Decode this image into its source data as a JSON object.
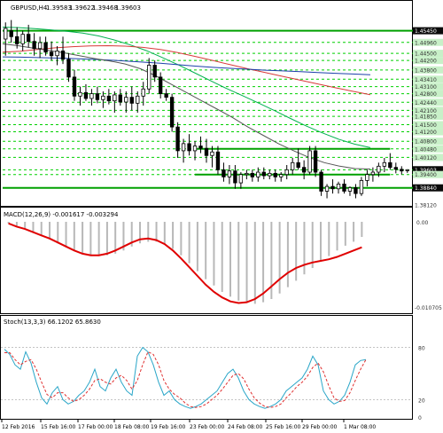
{
  "chart_data": [
    {
      "type": "candlestick",
      "symbol_line": "GBPUSD,H4",
      "ohlc_values": [
        "1.39583",
        "1.39622",
        "1.39468",
        "1.39603"
      ],
      "ylim": [
        1.3812,
        1.4622
      ],
      "y_tick_labels": [
        "1.45450",
        "1.44960",
        "1.44500",
        "1.44200",
        "1.43800",
        "1.43410",
        "1.43100",
        "1.42800",
        "1.42440",
        "1.42100",
        "1.41850",
        "1.41500",
        "1.41200",
        "1.40800",
        "1.40480",
        "1.40120",
        "1.39603",
        "1.39400",
        "1.38840",
        "1.38120"
      ],
      "x_tick_labels": [
        "12 Feb 2016",
        "15 Feb 16:00",
        "17 Feb 00:00",
        "18 Feb 08:00",
        "19 Feb 16:00",
        "23 Feb 00:00",
        "24 Feb 08:00",
        "25 Feb 16:00",
        "29 Feb 00:00",
        "1 Mar 08:00"
      ],
      "candles": [
        {
          "o": 1.451,
          "h": 1.458,
          "l": 1.444,
          "c": 1.4555
        },
        {
          "o": 1.4545,
          "h": 1.459,
          "l": 1.4495,
          "c": 1.452
        },
        {
          "o": 1.452,
          "h": 1.456,
          "l": 1.447,
          "c": 1.449
        },
        {
          "o": 1.449,
          "h": 1.4545,
          "l": 1.446,
          "c": 1.453
        },
        {
          "o": 1.453,
          "h": 1.457,
          "l": 1.4475,
          "c": 1.45
        },
        {
          "o": 1.45,
          "h": 1.4535,
          "l": 1.444,
          "c": 1.447
        },
        {
          "o": 1.447,
          "h": 1.452,
          "l": 1.443,
          "c": 1.4495
        },
        {
          "o": 1.4495,
          "h": 1.452,
          "l": 1.444,
          "c": 1.4455
        },
        {
          "o": 1.4455,
          "h": 1.45,
          "l": 1.442,
          "c": 1.444
        },
        {
          "o": 1.444,
          "h": 1.448,
          "l": 1.44,
          "c": 1.446
        },
        {
          "o": 1.446,
          "h": 1.452,
          "l": 1.4405,
          "c": 1.4425
        },
        {
          "o": 1.4425,
          "h": 1.445,
          "l": 1.433,
          "c": 1.435
        },
        {
          "o": 1.435,
          "h": 1.438,
          "l": 1.425,
          "c": 1.427
        },
        {
          "o": 1.427,
          "h": 1.431,
          "l": 1.423,
          "c": 1.4285
        },
        {
          "o": 1.4285,
          "h": 1.432,
          "l": 1.425,
          "c": 1.426
        },
        {
          "o": 1.426,
          "h": 1.43,
          "l": 1.423,
          "c": 1.428
        },
        {
          "o": 1.428,
          "h": 1.431,
          "l": 1.424,
          "c": 1.4255
        },
        {
          "o": 1.4255,
          "h": 1.429,
          "l": 1.422,
          "c": 1.427
        },
        {
          "o": 1.427,
          "h": 1.43,
          "l": 1.4235,
          "c": 1.425
        },
        {
          "o": 1.425,
          "h": 1.429,
          "l": 1.42,
          "c": 1.4275
        },
        {
          "o": 1.4275,
          "h": 1.43,
          "l": 1.423,
          "c": 1.4245
        },
        {
          "o": 1.4245,
          "h": 1.429,
          "l": 1.42,
          "c": 1.4265
        },
        {
          "o": 1.4265,
          "h": 1.431,
          "l": 1.421,
          "c": 1.424
        },
        {
          "o": 1.424,
          "h": 1.429,
          "l": 1.42,
          "c": 1.427
        },
        {
          "o": 1.427,
          "h": 1.433,
          "l": 1.423,
          "c": 1.43
        },
        {
          "o": 1.43,
          "h": 1.443,
          "l": 1.428,
          "c": 1.44
        },
        {
          "o": 1.44,
          "h": 1.442,
          "l": 1.433,
          "c": 1.435
        },
        {
          "o": 1.435,
          "h": 1.437,
          "l": 1.426,
          "c": 1.428
        },
        {
          "o": 1.428,
          "h": 1.43,
          "l": 1.425,
          "c": 1.4265
        },
        {
          "o": 1.4265,
          "h": 1.428,
          "l": 1.412,
          "c": 1.414
        },
        {
          "o": 1.414,
          "h": 1.416,
          "l": 1.401,
          "c": 1.404
        },
        {
          "o": 1.404,
          "h": 1.409,
          "l": 1.399,
          "c": 1.407
        },
        {
          "o": 1.407,
          "h": 1.411,
          "l": 1.402,
          "c": 1.404
        },
        {
          "o": 1.404,
          "h": 1.408,
          "l": 1.4,
          "c": 1.406
        },
        {
          "o": 1.406,
          "h": 1.41,
          "l": 1.403,
          "c": 1.405
        },
        {
          "o": 1.405,
          "h": 1.409,
          "l": 1.399,
          "c": 1.402
        },
        {
          "o": 1.402,
          "h": 1.406,
          "l": 1.397,
          "c": 1.4035
        },
        {
          "o": 1.4035,
          "h": 1.406,
          "l": 1.394,
          "c": 1.396
        },
        {
          "o": 1.396,
          "h": 1.399,
          "l": 1.391,
          "c": 1.393
        },
        {
          "o": 1.393,
          "h": 1.398,
          "l": 1.39,
          "c": 1.3955
        },
        {
          "o": 1.3955,
          "h": 1.398,
          "l": 1.388,
          "c": 1.3905
        },
        {
          "o": 1.3905,
          "h": 1.395,
          "l": 1.388,
          "c": 1.394
        },
        {
          "o": 1.394,
          "h": 1.396,
          "l": 1.392,
          "c": 1.3945
        },
        {
          "o": 1.3945,
          "h": 1.396,
          "l": 1.391,
          "c": 1.393
        },
        {
          "o": 1.393,
          "h": 1.397,
          "l": 1.391,
          "c": 1.395
        },
        {
          "o": 1.395,
          "h": 1.397,
          "l": 1.392,
          "c": 1.3935
        },
        {
          "o": 1.3935,
          "h": 1.396,
          "l": 1.392,
          "c": 1.3945
        },
        {
          "o": 1.3945,
          "h": 1.396,
          "l": 1.391,
          "c": 1.393
        },
        {
          "o": 1.393,
          "h": 1.395,
          "l": 1.391,
          "c": 1.394
        },
        {
          "o": 1.394,
          "h": 1.398,
          "l": 1.392,
          "c": 1.396
        },
        {
          "o": 1.396,
          "h": 1.401,
          "l": 1.394,
          "c": 1.399
        },
        {
          "o": 1.399,
          "h": 1.405,
          "l": 1.396,
          "c": 1.397
        },
        {
          "o": 1.397,
          "h": 1.4,
          "l": 1.392,
          "c": 1.395
        },
        {
          "o": 1.395,
          "h": 1.406,
          "l": 1.394,
          "c": 1.404
        },
        {
          "o": 1.404,
          "h": 1.406,
          "l": 1.393,
          "c": 1.395
        },
        {
          "o": 1.395,
          "h": 1.396,
          "l": 1.385,
          "c": 1.387
        },
        {
          "o": 1.387,
          "h": 1.39,
          "l": 1.384,
          "c": 1.389
        },
        {
          "o": 1.389,
          "h": 1.392,
          "l": 1.386,
          "c": 1.388
        },
        {
          "o": 1.388,
          "h": 1.391,
          "l": 1.386,
          "c": 1.39
        },
        {
          "o": 1.39,
          "h": 1.392,
          "l": 1.386,
          "c": 1.387
        },
        {
          "o": 1.387,
          "h": 1.389,
          "l": 1.385,
          "c": 1.3885
        },
        {
          "o": 1.3885,
          "h": 1.39,
          "l": 1.384,
          "c": 1.386
        },
        {
          "o": 1.386,
          "h": 1.393,
          "l": 1.385,
          "c": 1.3915
        },
        {
          "o": 1.3915,
          "h": 1.396,
          "l": 1.389,
          "c": 1.394
        },
        {
          "o": 1.394,
          "h": 1.397,
          "l": 1.391,
          "c": 1.395
        },
        {
          "o": 1.395,
          "h": 1.399,
          "l": 1.393,
          "c": 1.3975
        },
        {
          "o": 1.3975,
          "h": 1.401,
          "l": 1.395,
          "c": 1.399
        },
        {
          "o": 1.399,
          "h": 1.403,
          "l": 1.396,
          "c": 1.397
        },
        {
          "o": 1.397,
          "h": 1.399,
          "l": 1.3945,
          "c": 1.3962
        },
        {
          "o": 1.3962,
          "h": 1.3975,
          "l": 1.394,
          "c": 1.3955
        },
        {
          "o": 1.3958,
          "h": 1.3962,
          "l": 1.3947,
          "c": 1.396
        }
      ],
      "moving_averages": [
        {
          "name": "",
          "color": "#00b14f",
          "values": [
            1.456,
            1.4558,
            1.4554,
            1.4549,
            1.4543,
            1.4535,
            1.4523,
            1.4506,
            1.4485,
            1.4461,
            1.4432,
            1.4401,
            1.4368,
            1.4335,
            1.4302,
            1.4272,
            1.4241,
            1.4209,
            1.4176,
            1.4144,
            1.4115,
            1.4089,
            1.4068,
            1.4053
          ]
        },
        {
          "name": "",
          "color": "#d93a3a",
          "values": [
            1.4455,
            1.4459,
            1.4466,
            1.4473,
            1.4478,
            1.4481,
            1.4482,
            1.448,
            1.4475,
            1.4466,
            1.4453,
            1.4437,
            1.442,
            1.4402,
            1.4385,
            1.4369,
            1.4353,
            1.4337,
            1.4321,
            1.4305,
            1.429,
            1.4276
          ]
        },
        {
          "name": "",
          "color": "#1c3faa",
          "values": [
            1.4435,
            1.4434,
            1.4432,
            1.443,
            1.4428,
            1.4425,
            1.4422,
            1.4418,
            1.4413,
            1.4408,
            1.4402,
            1.4396,
            1.4391,
            1.4387,
            1.4383,
            1.4379,
            1.4376,
            1.4373,
            1.4369,
            1.4366,
            1.4363,
            1.436
          ]
        },
        {
          "name": "",
          "color": "#555555",
          "values": [
            1.449,
            1.4482,
            1.4472,
            1.4462,
            1.4452,
            1.444,
            1.4428,
            1.4418,
            1.4405,
            1.4385,
            1.4355,
            1.432,
            1.4285,
            1.425,
            1.4215,
            1.418,
            1.414,
            1.4105,
            1.407,
            1.404,
            1.4012,
            1.399,
            1.3975,
            1.3965,
            1.3963
          ]
        }
      ],
      "horizontal_levels": [
        1.4545,
        1.4048,
        1.394,
        1.3884
      ],
      "dashed_levels": [
        1.4496,
        1.445,
        1.442,
        1.438,
        1.4341,
        1.431,
        1.428,
        1.4244,
        1.421,
        1.4185,
        1.415,
        1.412,
        1.408,
        1.4048,
        1.4012,
        1.396,
        1.394,
        1.3884
      ],
      "current_price": 1.39603,
      "colors": {
        "level": "#00a000",
        "dashed": "#00d000",
        "candle": "#000000",
        "price_tag_bg": "#0a0a0a",
        "price_tag_text": "#ffffff"
      }
    },
    {
      "type": "histogram+line",
      "title": "MACD(12,26,9) -0.001617 -0.003294",
      "y_tick_labels": [
        "0.00",
        "-0.010705"
      ],
      "ylim": [
        -0.0107,
        0.0
      ],
      "histogram": [
        -0.0002,
        -0.0005,
        -0.0008,
        -0.0012,
        -0.0017,
        -0.0022,
        -0.0027,
        -0.0032,
        -0.0036,
        -0.004,
        -0.0042,
        -0.0043,
        -0.0042,
        -0.004,
        -0.0036,
        -0.0031,
        -0.0027,
        -0.0025,
        -0.0025,
        -0.0028,
        -0.0034,
        -0.0042,
        -0.0052,
        -0.0062,
        -0.0072,
        -0.008,
        -0.0088,
        -0.0094,
        -0.0099,
        -0.0102,
        -0.0103,
        -0.0101,
        -0.0097,
        -0.009,
        -0.0082,
        -0.0074,
        -0.0066,
        -0.0058,
        -0.005,
        -0.0043,
        -0.0036,
        -0.003,
        -0.0025,
        -0.0019
      ],
      "signal": [
        -0.0002,
        -0.0006,
        -0.0009,
        -0.0013,
        -0.0017,
        -0.0021,
        -0.0026,
        -0.0031,
        -0.0036,
        -0.004,
        -0.0042,
        -0.0042,
        -0.004,
        -0.0036,
        -0.0031,
        -0.0026,
        -0.0022,
        -0.0021,
        -0.0023,
        -0.0028,
        -0.0036,
        -0.0046,
        -0.0057,
        -0.0068,
        -0.0079,
        -0.0088,
        -0.0095,
        -0.01,
        -0.0102,
        -0.0101,
        -0.0097,
        -0.009,
        -0.0081,
        -0.0072,
        -0.0064,
        -0.0058,
        -0.0054,
        -0.0051,
        -0.0049,
        -0.0047,
        -0.0044,
        -0.004,
        -0.0036,
        -0.0032
      ],
      "colors": {
        "histogram": "#b8b8b8",
        "signal": "#e00000"
      }
    },
    {
      "type": "line",
      "title": "Stoch(13,3,3) 66.1202 65.8630",
      "y_tick_labels": [
        "80",
        "20",
        "0"
      ],
      "ylim": [
        0,
        100
      ],
      "series": [
        {
          "name": "",
          "color": "#2aa6c8",
          "values": [
            78,
            72,
            60,
            55,
            75,
            62,
            40,
            22,
            15,
            28,
            35,
            20,
            15,
            18,
            25,
            30,
            40,
            55,
            35,
            30,
            45,
            55,
            40,
            30,
            25,
            70,
            80,
            75,
            60,
            40,
            25,
            30,
            20,
            15,
            12,
            10,
            12,
            15,
            20,
            25,
            30,
            40,
            50,
            55,
            45,
            30,
            20,
            15,
            12,
            10,
            12,
            15,
            20,
            30,
            35,
            40,
            45,
            55,
            70,
            60,
            30,
            20,
            15,
            18,
            25,
            40,
            60,
            65,
            66
          ]
        },
        {
          "name": "",
          "color": "#e03030",
          "values": [
            74,
            74,
            66,
            60,
            64,
            66,
            55,
            40,
            26,
            22,
            28,
            28,
            22,
            18,
            20,
            25,
            32,
            42,
            44,
            40,
            38,
            45,
            48,
            42,
            32,
            42,
            60,
            75,
            72,
            60,
            42,
            32,
            26,
            22,
            16,
            12,
            11,
            12,
            15,
            20,
            25,
            32,
            40,
            48,
            50,
            44,
            32,
            22,
            16,
            12,
            11,
            12,
            15,
            22,
            28,
            35,
            40,
            47,
            57,
            62,
            52,
            36,
            22,
            18,
            19,
            28,
            42,
            55,
            66
          ]
        }
      ],
      "colors": {
        "level": "#b0b0b0"
      }
    }
  ]
}
